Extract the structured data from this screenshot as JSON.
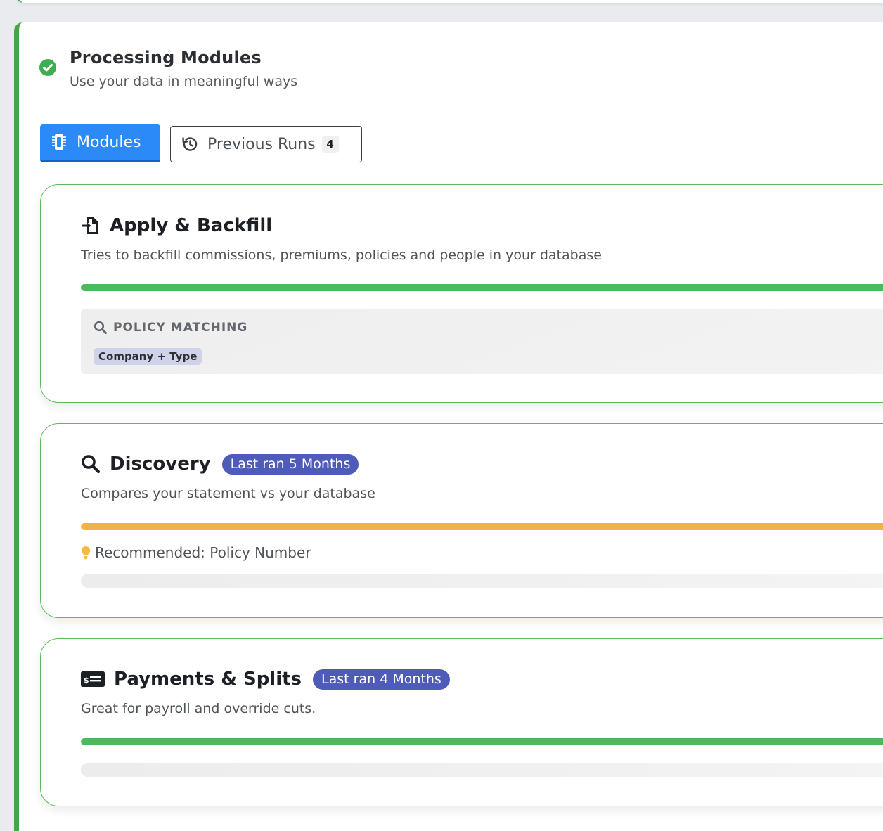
{
  "header": {
    "title": "Processing Modules",
    "subtitle": "Use your data in meaningful ways",
    "status_icon": "check-circle-icon"
  },
  "tabs": [
    {
      "label": "Modules",
      "icon": "microchip-icon",
      "active": true
    },
    {
      "label": "Previous Runs",
      "icon": "history-icon",
      "count": "4",
      "active": false
    }
  ],
  "modules": [
    {
      "title": "Apply & Backfill",
      "icon": "file-import-icon",
      "description": "Tries to backfill commissions, premiums, policies and people in your database",
      "progress_color": "#4cba5a",
      "progress": 1.0,
      "matching": {
        "label": "POLICY MATCHING",
        "icon": "search-icon",
        "chip": "Company + Type"
      }
    },
    {
      "title": "Discovery",
      "icon": "search-icon",
      "badge": "Last ran 5 Months",
      "description": "Compares your statement vs your database",
      "progress_color": "#f6b04a",
      "progress": 1.0,
      "recommendation": "Recommended: Policy Number",
      "recommendation_icon": "lightbulb-icon"
    },
    {
      "title": "Payments & Splits",
      "icon": "money-check-icon",
      "badge": "Last ran 4 Months",
      "description": "Great for payroll and override cuts.",
      "progress_color": "#4cba5a",
      "progress": 1.0
    }
  ],
  "colors": {
    "accent_green": "#47a447",
    "primary_blue": "#2b8af7",
    "badge_indigo": "#4e5bb8"
  }
}
